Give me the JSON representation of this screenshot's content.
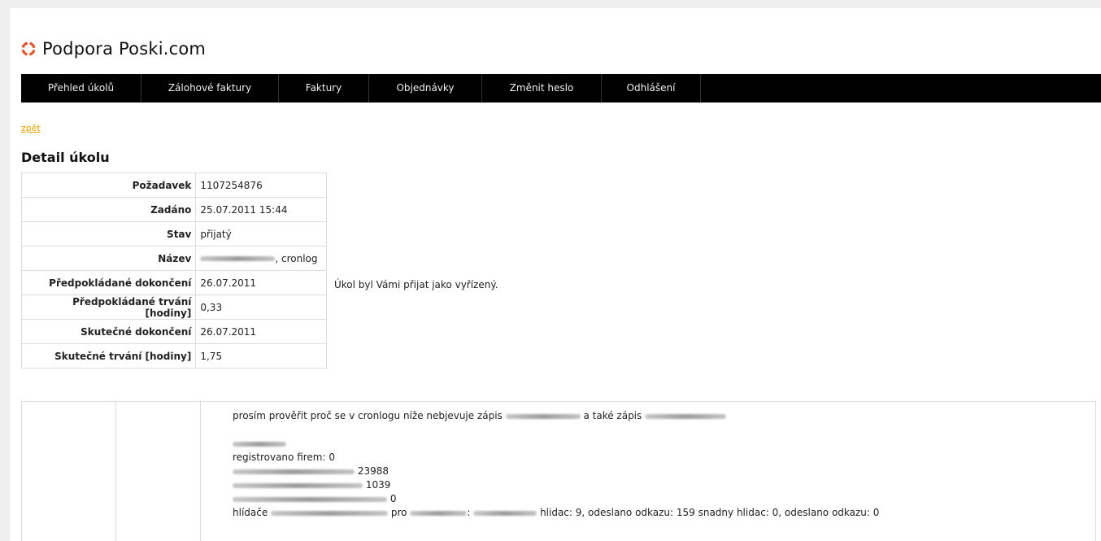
{
  "brand": {
    "title": "Podpora Poski.com",
    "accent": "#e2542b"
  },
  "nav": [
    "Přehled úkolů",
    "Zálohové faktury",
    "Faktury",
    "Objednávky",
    "Změnit heslo",
    "Odhlášení"
  ],
  "back_link": "zpět",
  "heading": "Detail úkolu",
  "detail": {
    "rows": [
      {
        "label": "Požadavek",
        "value": "1107254876"
      },
      {
        "label": "Zadáno",
        "value": "25.07.2011 15:44"
      },
      {
        "label": "Stav",
        "value": "přijatý"
      },
      {
        "label": "Název",
        "value": ", cronlog"
      },
      {
        "label": "Předpokládané dokončení",
        "value": "26.07.2011"
      },
      {
        "label": "Předpokládané trvání [hodiny]",
        "value": "0,33"
      },
      {
        "label": "Skutečné dokončení",
        "value": "26.07.2011"
      },
      {
        "label": "Skutečné trvání [hodiny]",
        "value": "1,75"
      }
    ]
  },
  "status_note": "Úkol byl Vámi přijat jako vyřízený.",
  "comment": {
    "line1_a": "prosím prověřit proč se v cronlogu níže nebjevuje zápis",
    "line1_b": "a také zápis",
    "registered": "registrovano firem: 0",
    "n1": "23988",
    "n2": "1039",
    "n3": "0",
    "hlidace_prefix": "hlídače",
    "hlidace_pro": "pro",
    "hlidace_sep": ":",
    "hlidace_tail": "hlidac: 9, odeslano odkazu: 159 snadny hlidac: 0, odeslano odkazu: 0"
  }
}
